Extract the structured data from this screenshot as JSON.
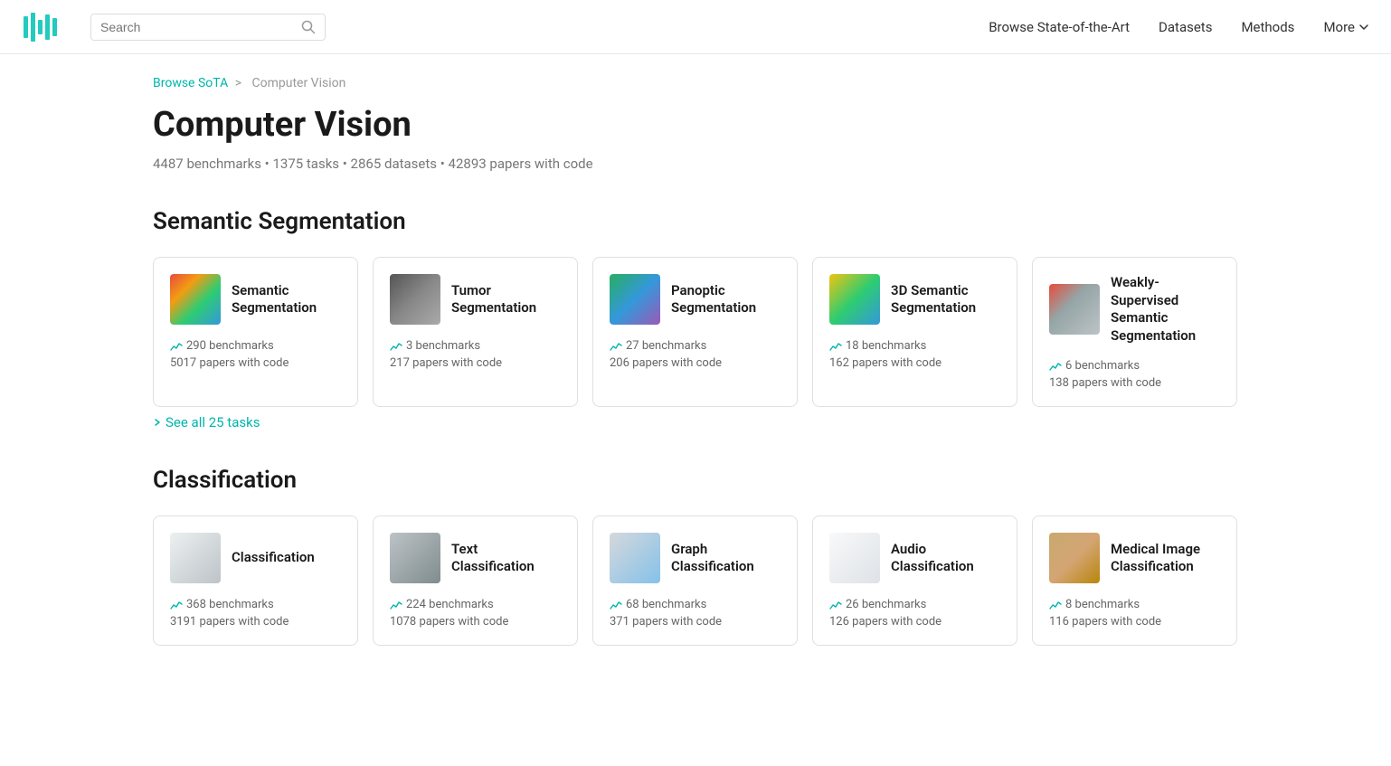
{
  "nav": {
    "browse_sota": "Browse State-of-the-Art",
    "datasets": "Datasets",
    "methods": "Methods",
    "more": "More",
    "search_placeholder": "Search"
  },
  "breadcrumb": {
    "parent_label": "Browse SoTA",
    "separator": ">",
    "current": "Computer Vision"
  },
  "page": {
    "title": "Computer Vision",
    "stats": "4487 benchmarks • 1375 tasks • 2865 datasets • 42893 papers with code"
  },
  "sections": [
    {
      "id": "semantic-segmentation",
      "title": "Semantic Segmentation",
      "see_all_label": "See all 25 tasks",
      "cards": [
        {
          "name": "Semantic Segmentation",
          "thumb_class": "thumb-segmentation",
          "benchmarks": "290 benchmarks",
          "papers": "5017 papers with code"
        },
        {
          "name": "Tumor Segmentation",
          "thumb_class": "thumb-tumor",
          "benchmarks": "3 benchmarks",
          "papers": "217 papers with code"
        },
        {
          "name": "Panoptic Segmentation",
          "thumb_class": "thumb-panoptic",
          "benchmarks": "27 benchmarks",
          "papers": "206 papers with code"
        },
        {
          "name": "3D Semantic Segmentation",
          "thumb_class": "thumb-3d",
          "benchmarks": "18 benchmarks",
          "papers": "162 papers with code"
        },
        {
          "name": "Weakly-Supervised Semantic Segmentation",
          "thumb_class": "thumb-weakly",
          "benchmarks": "6 benchmarks",
          "papers": "138 papers with code"
        }
      ]
    },
    {
      "id": "classification",
      "title": "Classification",
      "see_all_label": "",
      "cards": [
        {
          "name": "Classification",
          "thumb_class": "thumb-classification",
          "benchmarks": "368 benchmarks",
          "papers": "3191 papers with code"
        },
        {
          "name": "Text Classification",
          "thumb_class": "thumb-text-class",
          "benchmarks": "224 benchmarks",
          "papers": "1078 papers with code"
        },
        {
          "name": "Graph Classification",
          "thumb_class": "thumb-graph",
          "benchmarks": "68 benchmarks",
          "papers": "371 papers with code"
        },
        {
          "name": "Audio Classification",
          "thumb_class": "thumb-audio",
          "benchmarks": "26 benchmarks",
          "papers": "126 papers with code"
        },
        {
          "name": "Medical Image Classification",
          "thumb_class": "thumb-medical",
          "benchmarks": "8 benchmarks",
          "papers": "116 papers with code"
        }
      ]
    }
  ]
}
